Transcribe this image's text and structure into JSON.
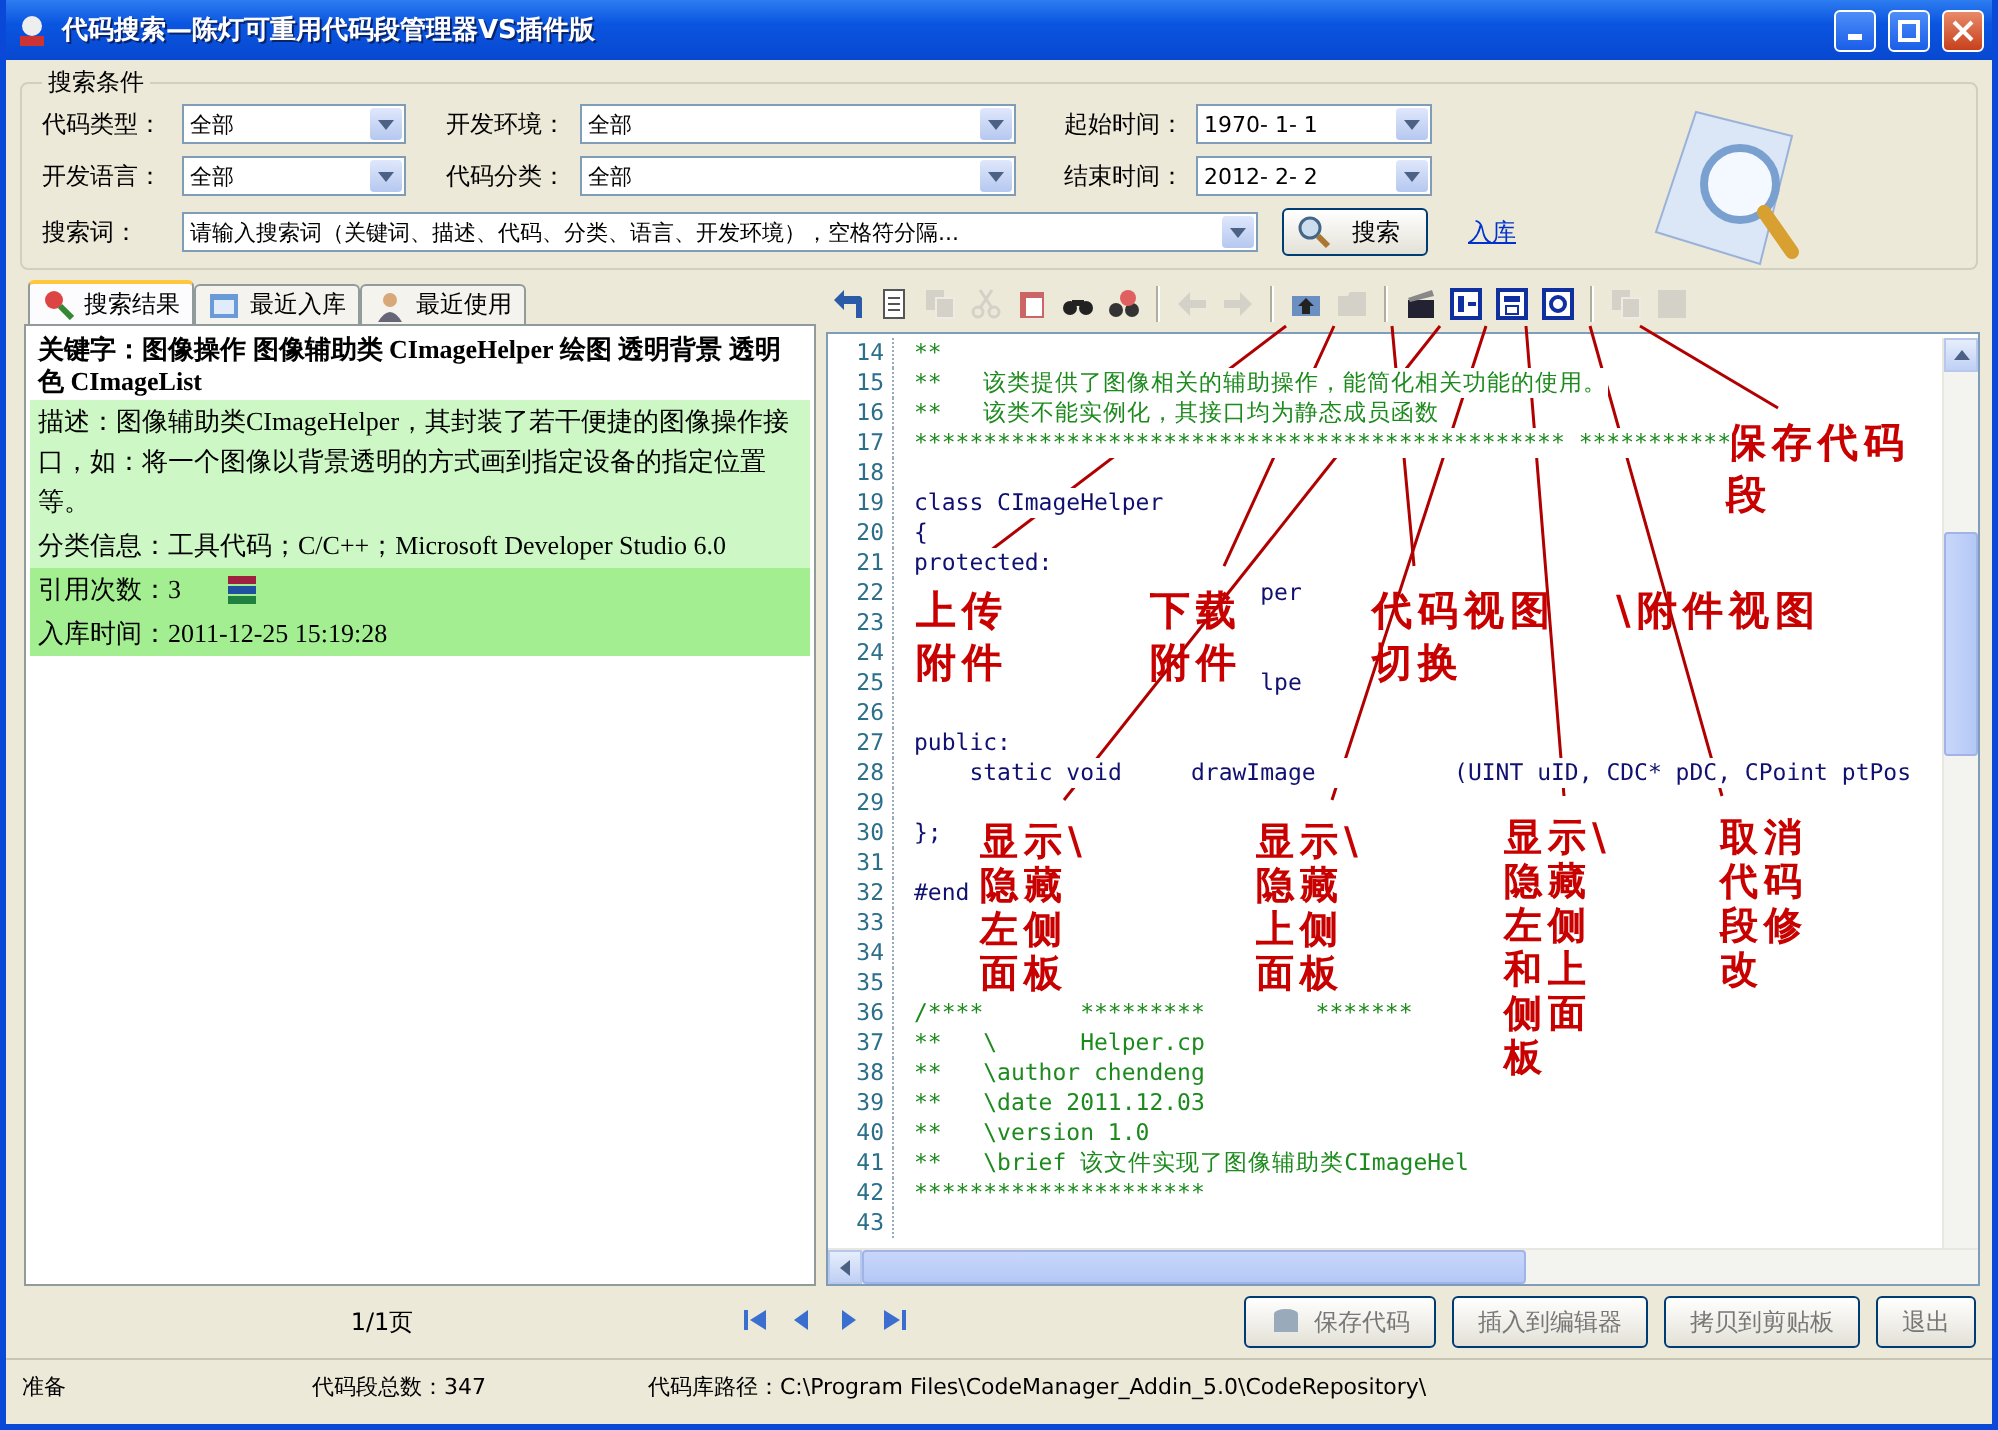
{
  "window": {
    "title": "代码搜索—陈灯可重用代码段管理器VS插件版"
  },
  "search_conditions": {
    "title": "搜索条件",
    "fields": [
      {
        "label": "代码类型：",
        "value": "全部"
      },
      {
        "label": "开发环境：",
        "value": "全部"
      },
      {
        "label": "起始时间：",
        "value": "1970- 1- 1"
      },
      {
        "label": "开发语言：",
        "value": "全部"
      },
      {
        "label": "代码分类：",
        "value": "全部"
      },
      {
        "label": "结束时间：",
        "value": "2012- 2- 2"
      }
    ],
    "keyword_label": "搜索词：",
    "keyword_value": "请输入搜索词（关键词、描述、代码、分类、语言、开发环境），空格符分隔...",
    "search_button": "搜索",
    "add_link": "入库"
  },
  "tabs": [
    {
      "label": "搜索结果",
      "selected": true
    },
    {
      "label": "最近入库",
      "selected": false
    },
    {
      "label": "最近使用",
      "selected": false
    }
  ],
  "results": [
    {
      "title": "关键字：图像操作 图像辅助类 CImageHelper 绘图 透明背景 透明色 CImageList",
      "fields": [
        {
          "text": "描述：图像辅助类CImageHelper，其封装了若干便捷的图像操作接口，如：将一个图像以背景透明的方式画到指定设备的指定位置等。",
          "kind": "text",
          "color": "#cdf7c4"
        },
        {
          "text": "分类信息：工具代码；C/C++；Microsoft Developer Studio 6.0",
          "kind": "text",
          "color": "#cdf7c4"
        },
        {
          "text": "引用次数：3",
          "kind": "count",
          "color": "#a2ee90"
        },
        {
          "text": "入库时间：2011-12-25 15:19:28",
          "kind": "text",
          "color": "#a2ee90"
        }
      ]
    }
  ],
  "toolbar": [
    {
      "kind": "back",
      "disabled": false
    },
    {
      "kind": "document",
      "disabled": false
    },
    {
      "kind": "copy",
      "disabled": true
    },
    {
      "kind": "cut",
      "disabled": true
    },
    {
      "kind": "paste",
      "disabled": false
    },
    {
      "kind": "find",
      "disabled": false
    },
    {
      "kind": "replace",
      "disabled": false
    },
    {
      "kind": "separator"
    },
    {
      "kind": "undo",
      "disabled": true
    },
    {
      "kind": "redo",
      "disabled": true
    },
    {
      "kind": "separator"
    },
    {
      "kind": "upload",
      "disabled": false
    },
    {
      "kind": "folder",
      "disabled": true
    },
    {
      "kind": "separator"
    },
    {
      "kind": "clapper",
      "disabled": false
    },
    {
      "kind": "view-left",
      "disabled": false
    },
    {
      "kind": "view-top",
      "disabled": false
    },
    {
      "kind": "view-both",
      "disabled": false
    },
    {
      "kind": "separator"
    },
    {
      "kind": "duplicate",
      "disabled": true
    },
    {
      "kind": "save",
      "disabled": true
    }
  ],
  "code_lines": [
    {
      "number": "14",
      "text": "**",
      "kind": "comment"
    },
    {
      "number": "15",
      "text": "**   该类提供了图像相关的辅助操作，能简化相关功能的使用。",
      "kind": "comment"
    },
    {
      "number": "16",
      "text": "**   该类不能实例化，其接口均为静态成员函数",
      "kind": "comment"
    },
    {
      "number": "17",
      "text": "*********************************************** ***********",
      "kind": "comment"
    },
    {
      "number": "18"
    },
    {
      "number": "19",
      "text": "class CImageHelper",
      "kind": "code"
    },
    {
      "number": "20",
      "text": "{",
      "kind": "code"
    },
    {
      "number": "21",
      "text": "protected:",
      "kind": "code"
    },
    {
      "number": "22",
      "text": "                         per",
      "kind": "code"
    },
    {
      "number": "23"
    },
    {
      "number": "24"
    },
    {
      "number": "25",
      "text": "                         lpe",
      "kind": "code"
    },
    {
      "number": "26"
    },
    {
      "number": "27",
      "text": "public:",
      "kind": "code"
    },
    {
      "number": "28",
      "text": "    static void     drawImage          (UINT uID, CDC* pDC, CPoint ptPos",
      "kind": "code"
    },
    {
      "number": "29"
    },
    {
      "number": "30",
      "text": "};",
      "kind": "code"
    },
    {
      "number": "31"
    },
    {
      "number": "32",
      "text": "#end",
      "kind": "code"
    },
    {
      "number": "33"
    },
    {
      "number": "34"
    },
    {
      "number": "35"
    },
    {
      "number": "36",
      "text": "/****       *********        *******",
      "kind": "comment"
    },
    {
      "number": "37",
      "text": "**   \\      Helper.cp",
      "kind": "comment"
    },
    {
      "number": "38",
      "text": "**   \\author chendeng",
      "kind": "comment"
    },
    {
      "number": "39",
      "text": "**   \\date 2011.12.03",
      "kind": "comment"
    },
    {
      "number": "40",
      "text": "**   \\version 1.0",
      "kind": "comment"
    },
    {
      "number": "41",
      "text": "**   \\brief 该文件实现了图像辅助类CImageHel",
      "kind": "comment"
    },
    {
      "number": "42",
      "text": "*********************",
      "kind": "comment"
    },
    {
      "number": "43"
    }
  ],
  "pager": {
    "text": "1/1页"
  },
  "buttons": [
    "保存代码",
    "插入到编辑器",
    "拷贝到剪贴板",
    "退出"
  ],
  "status_bar": [
    "准备",
    "代码段总数：347",
    "代码库路径：C:\\Program Files\\CodeManager_Addin_5.0\\CodeRepository\\"
  ],
  "annotations": [
    {
      "lines": [
        "上传",
        "附件"
      ]
    },
    {
      "lines": [
        "下载",
        "附件"
      ]
    },
    {
      "lines": [
        "代码视图",
        "切换"
      ]
    },
    {
      "lines": [
        "\\附件视图"
      ]
    },
    {
      "lines": [
        "保存代码",
        "段"
      ]
    },
    {
      "lines": [
        "显示\\",
        "隐藏",
        "左侧",
        "面板"
      ]
    },
    {
      "lines": [
        "显示\\",
        "隐藏",
        "上侧",
        "面板"
      ]
    },
    {
      "lines": [
        "显示\\",
        "隐藏",
        "左侧",
        "和上",
        "侧面",
        "板"
      ]
    },
    {
      "lines": [
        "取消",
        "代码",
        "段修",
        "改"
      ]
    }
  ]
}
